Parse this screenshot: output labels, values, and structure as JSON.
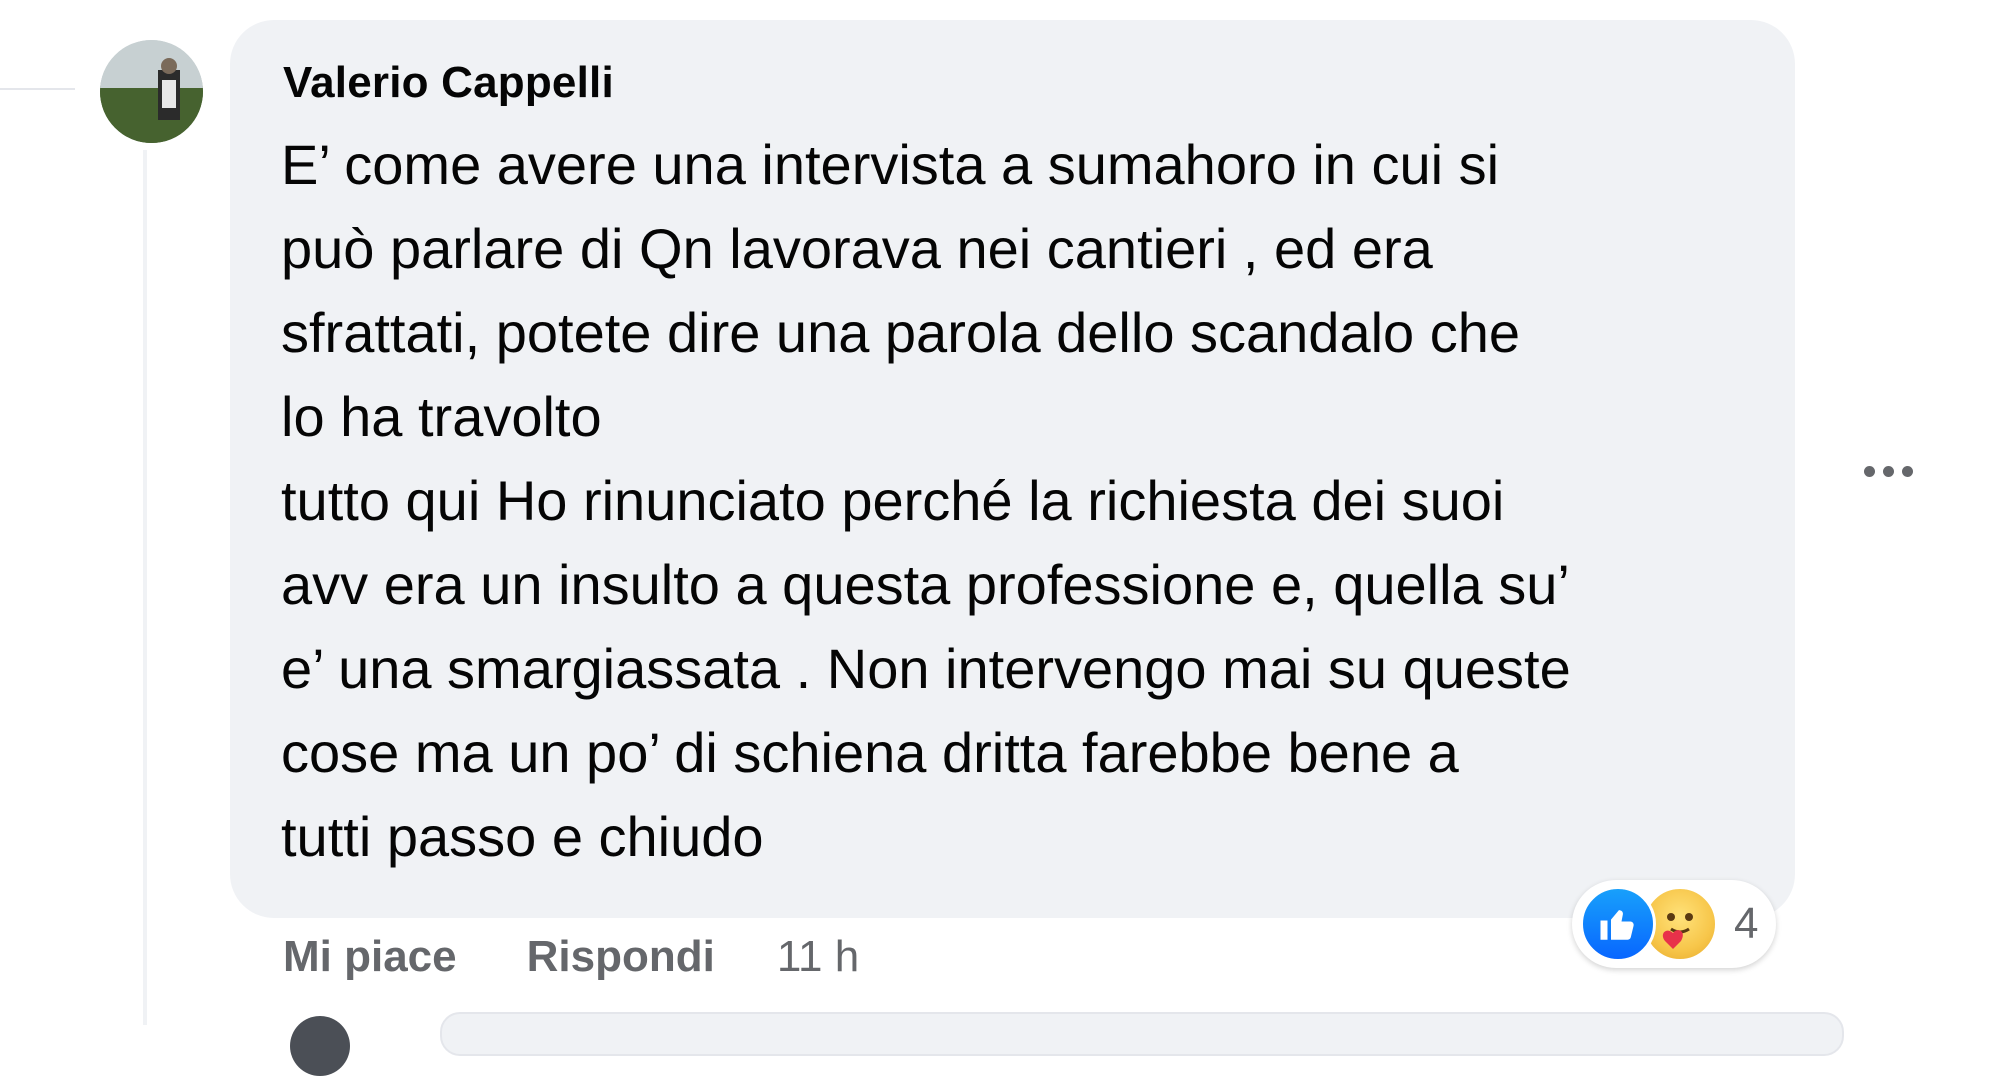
{
  "comment": {
    "author": "Valerio Cappelli",
    "text_lines": [
      "E’ come avere una intervista a sumahoro in cui si",
      "può parlare di Qn lavorava nei cantieri , ed era",
      "sfrattati, potete dire una parola dello scandalo che",
      "lo ha travolto",
      "tutto qui Ho rinunciato perché la richiesta dei suoi",
      "avv era un insulto a questa professione e, quella su’",
      "e’ una smargiassata . Non intervengo mai su queste",
      "cose ma un po’ di schiena dritta farebbe bene a",
      "tutti passo e chiudo"
    ],
    "reactions": {
      "icons": [
        "like-icon",
        "care-icon"
      ],
      "count": "4"
    },
    "actions": {
      "like_label": "Mi piace",
      "reply_label": "Rispondi",
      "timestamp": "11 h"
    }
  },
  "colors": {
    "bubble": "#f0f2f5",
    "text": "#050505",
    "secondary_text": "#65676b",
    "like_blue": "#0866ff"
  }
}
